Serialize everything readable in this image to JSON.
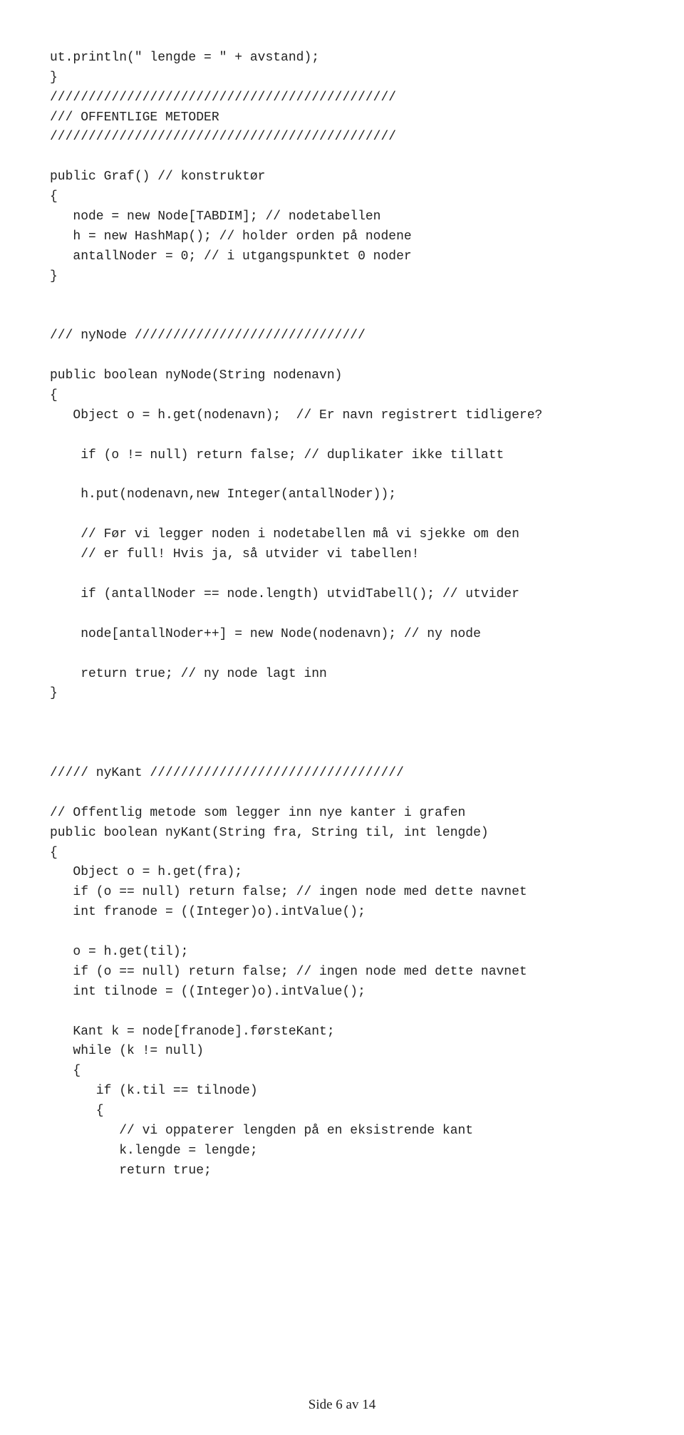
{
  "code": {
    "l01": "ut.println(\" lengde = \" + avstand);",
    "l02": "}",
    "l03": "/////////////////////////////////////////////",
    "l04": "/// OFFENTLIGE METODER",
    "l05": "/////////////////////////////////////////////",
    "l06": "public Graf() // konstruktør",
    "l07": "{",
    "l08": "   node = new Node[TABDIM]; // nodetabellen",
    "l09": "   h = new HashMap(); // holder orden på nodene",
    "l10": "   antallNoder = 0; // i utgangspunktet 0 noder",
    "l11": "}",
    "l12": "/// nyNode //////////////////////////////",
    "l13": "public boolean nyNode(String nodenavn)",
    "l14": "{",
    "l15": "   Object o = h.get(nodenavn);  // Er navn registrert tidligere?",
    "l16": "    if (o != null) return false; // duplikater ikke tillatt",
    "l17": "    h.put(nodenavn,new Integer(antallNoder));",
    "l18": "    // Før vi legger noden i nodetabellen må vi sjekke om den",
    "l19": "    // er full! Hvis ja, så utvider vi tabellen!",
    "l20": "    if (antallNoder == node.length) utvidTabell(); // utvider",
    "l21": "    node[antallNoder++] = new Node(nodenavn); // ny node",
    "l22": "    return true; // ny node lagt inn",
    "l23": "}",
    "l24": "///// nyKant /////////////////////////////////",
    "l25": "// Offentlig metode som legger inn nye kanter i grafen",
    "l26": "public boolean nyKant(String fra, String til, int lengde)",
    "l27": "{",
    "l28": "   Object o = h.get(fra);",
    "l29": "   if (o == null) return false; // ingen node med dette navnet",
    "l30": "   int franode = ((Integer)o).intValue();",
    "l31": "   o = h.get(til);",
    "l32": "   if (o == null) return false; // ingen node med dette navnet",
    "l33": "   int tilnode = ((Integer)o).intValue();",
    "l34": "   Kant k = node[franode].førsteKant;",
    "l35": "   while (k != null)",
    "l36": "   {",
    "l37": "      if (k.til == tilnode)",
    "l38": "      {",
    "l39": "         // vi oppaterer lengden på en eksistrende kant",
    "l40": "         k.lengde = lengde;",
    "l41": "         return true;"
  },
  "footer": {
    "text": "Side 6 av 14"
  }
}
